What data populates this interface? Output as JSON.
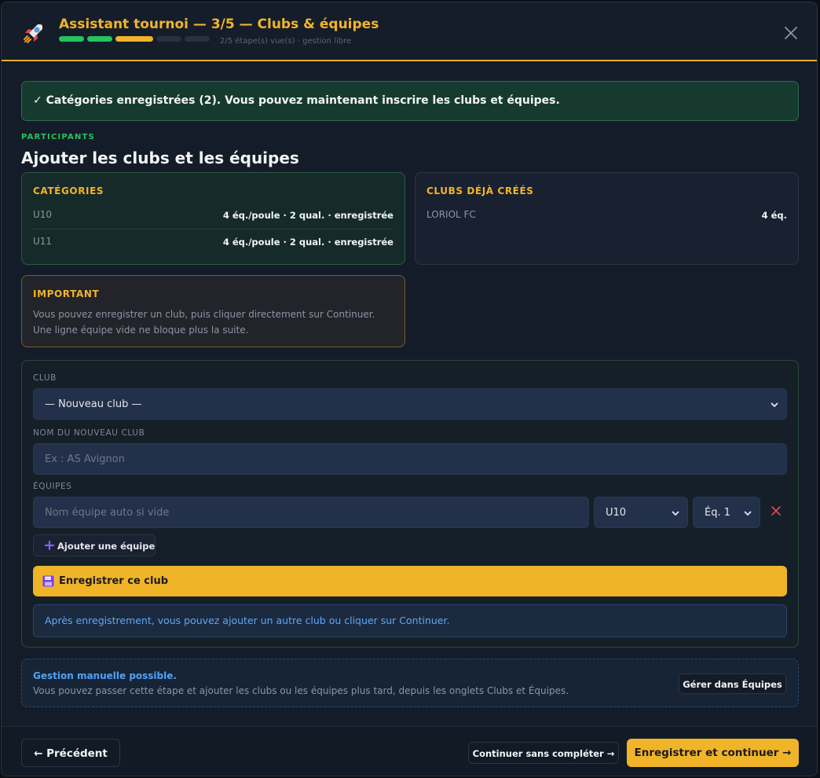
{
  "header": {
    "title": "Assistant tournoi — 3/5 — Clubs & équipes",
    "progress_text": "2/5 étape(s) vue(s) · gestion libre",
    "steps": [
      {
        "status": "done",
        "color": "#22c55e"
      },
      {
        "status": "done",
        "color": "#22c55e"
      },
      {
        "status": "current",
        "color": "#f0b429"
      },
      {
        "status": "pending",
        "color": "#263142"
      },
      {
        "status": "pending",
        "color": "#263142"
      }
    ]
  },
  "alert": {
    "text": "✓ Catégories enregistrées (2). Vous pouvez maintenant inscrire les clubs et équipes."
  },
  "section": {
    "eyebrow": "PARTICIPANTS",
    "title": "Ajouter les clubs et les équipes"
  },
  "categories": {
    "heading": "CATÉGORIES",
    "rows": [
      {
        "name": "U10",
        "value": "4 éq./poule · 2 qual. · enregistrée"
      },
      {
        "name": "U11",
        "value": "4 éq./poule · 2 qual. · enregistrée"
      }
    ]
  },
  "clubs": {
    "heading": "CLUBS DÉJÀ CRÉÉS",
    "rows": [
      {
        "name": "LORIOL FC",
        "value": "4 éq."
      }
    ]
  },
  "important": {
    "heading": "IMPORTANT",
    "text": "Vous pouvez enregistrer un club, puis cliquer directement sur Continuer. Une ligne équipe vide ne bloque plus la suite."
  },
  "form": {
    "club_label": "CLUB",
    "club_value": "— Nouveau club —",
    "new_club_label": "NOM DU NOUVEAU CLUB",
    "new_club_placeholder": "Ex : AS Avignon",
    "teams_label": "ÉQUIPES",
    "team_name_placeholder": "Nom équipe auto si vide",
    "team_category": "U10",
    "team_number": "Éq. 1",
    "add_team_label": "Ajouter une équipe",
    "save_club_label": "Enregistrer ce club",
    "info_text": "Après enregistrement, vous pouvez ajouter un autre club ou cliquer sur Continuer."
  },
  "manual": {
    "title": "Gestion manuelle possible.",
    "description": "Vous pouvez passer cette étape et ajouter les clubs ou les équipes plus tard, depuis les onglets Clubs et Équipes.",
    "button_label": "Gérer dans Équipes"
  },
  "footer": {
    "prev_label": "← Précédent",
    "skip_label": "Continuer sans compléter →",
    "next_label": "Enregistrer et continuer →"
  },
  "colors": {
    "accent": "#f0b429",
    "success": "#22c55e",
    "info": "#4fa3f7",
    "danger": "#e5484d"
  }
}
